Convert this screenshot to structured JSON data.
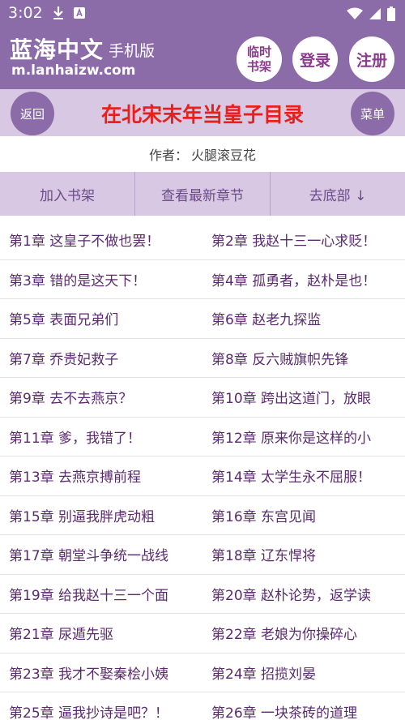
{
  "status": {
    "time": "3:02"
  },
  "header": {
    "site_name": "蓝海中文",
    "site_suffix": "手机版",
    "url": "m.lanhaizw.com",
    "temp_shelf_line1": "临时",
    "temp_shelf_line2": "书架",
    "login": "登录",
    "register": "注册"
  },
  "title_bar": {
    "back": "返回",
    "title": "在北宋末年当皇子目录",
    "menu": "菜单"
  },
  "author": {
    "label": "作者：",
    "name": "火腿滚豆花"
  },
  "actions": {
    "add_shelf": "加入书架",
    "latest": "查看最新章节",
    "bottom": "去底部 ↓"
  },
  "chapters": [
    [
      "第1章 这皇子不做也罢！",
      "第2章 我赵十三一心求贬！"
    ],
    [
      "第3章 错的是这天下！",
      "第4章 孤勇者，赵朴是也！"
    ],
    [
      "第5章 表面兄弟们",
      "第6章 赵老九探监"
    ],
    [
      "第7章 乔贵妃救子",
      "第8章 反六贼旗帜先锋"
    ],
    [
      "第9章 去不去燕京？",
      "第10章 跨出这道门，放眼"
    ],
    [
      "第11章 爹，我错了！",
      "第12章 原来你是这样的小"
    ],
    [
      "第13章 去燕京搏前程",
      "第14章 太学生永不屈服！"
    ],
    [
      "第15章 别逼我胖虎动粗",
      "第16章 东宫见闻"
    ],
    [
      "第17章 朝堂斗争统一战线",
      "第18章 辽东悍将"
    ],
    [
      "第19章 给我赵十三一个面",
      "第20章 赵朴论势，返学读"
    ],
    [
      "第21章 尿遁先驱",
      "第22章 老娘为你操碎心"
    ],
    [
      "第23章 我才不娶秦桧小姨",
      "第24章 招揽刘晏"
    ],
    [
      "第25章 逼我抄诗是吧？！",
      "第26章 一块茶砖的道理"
    ]
  ]
}
